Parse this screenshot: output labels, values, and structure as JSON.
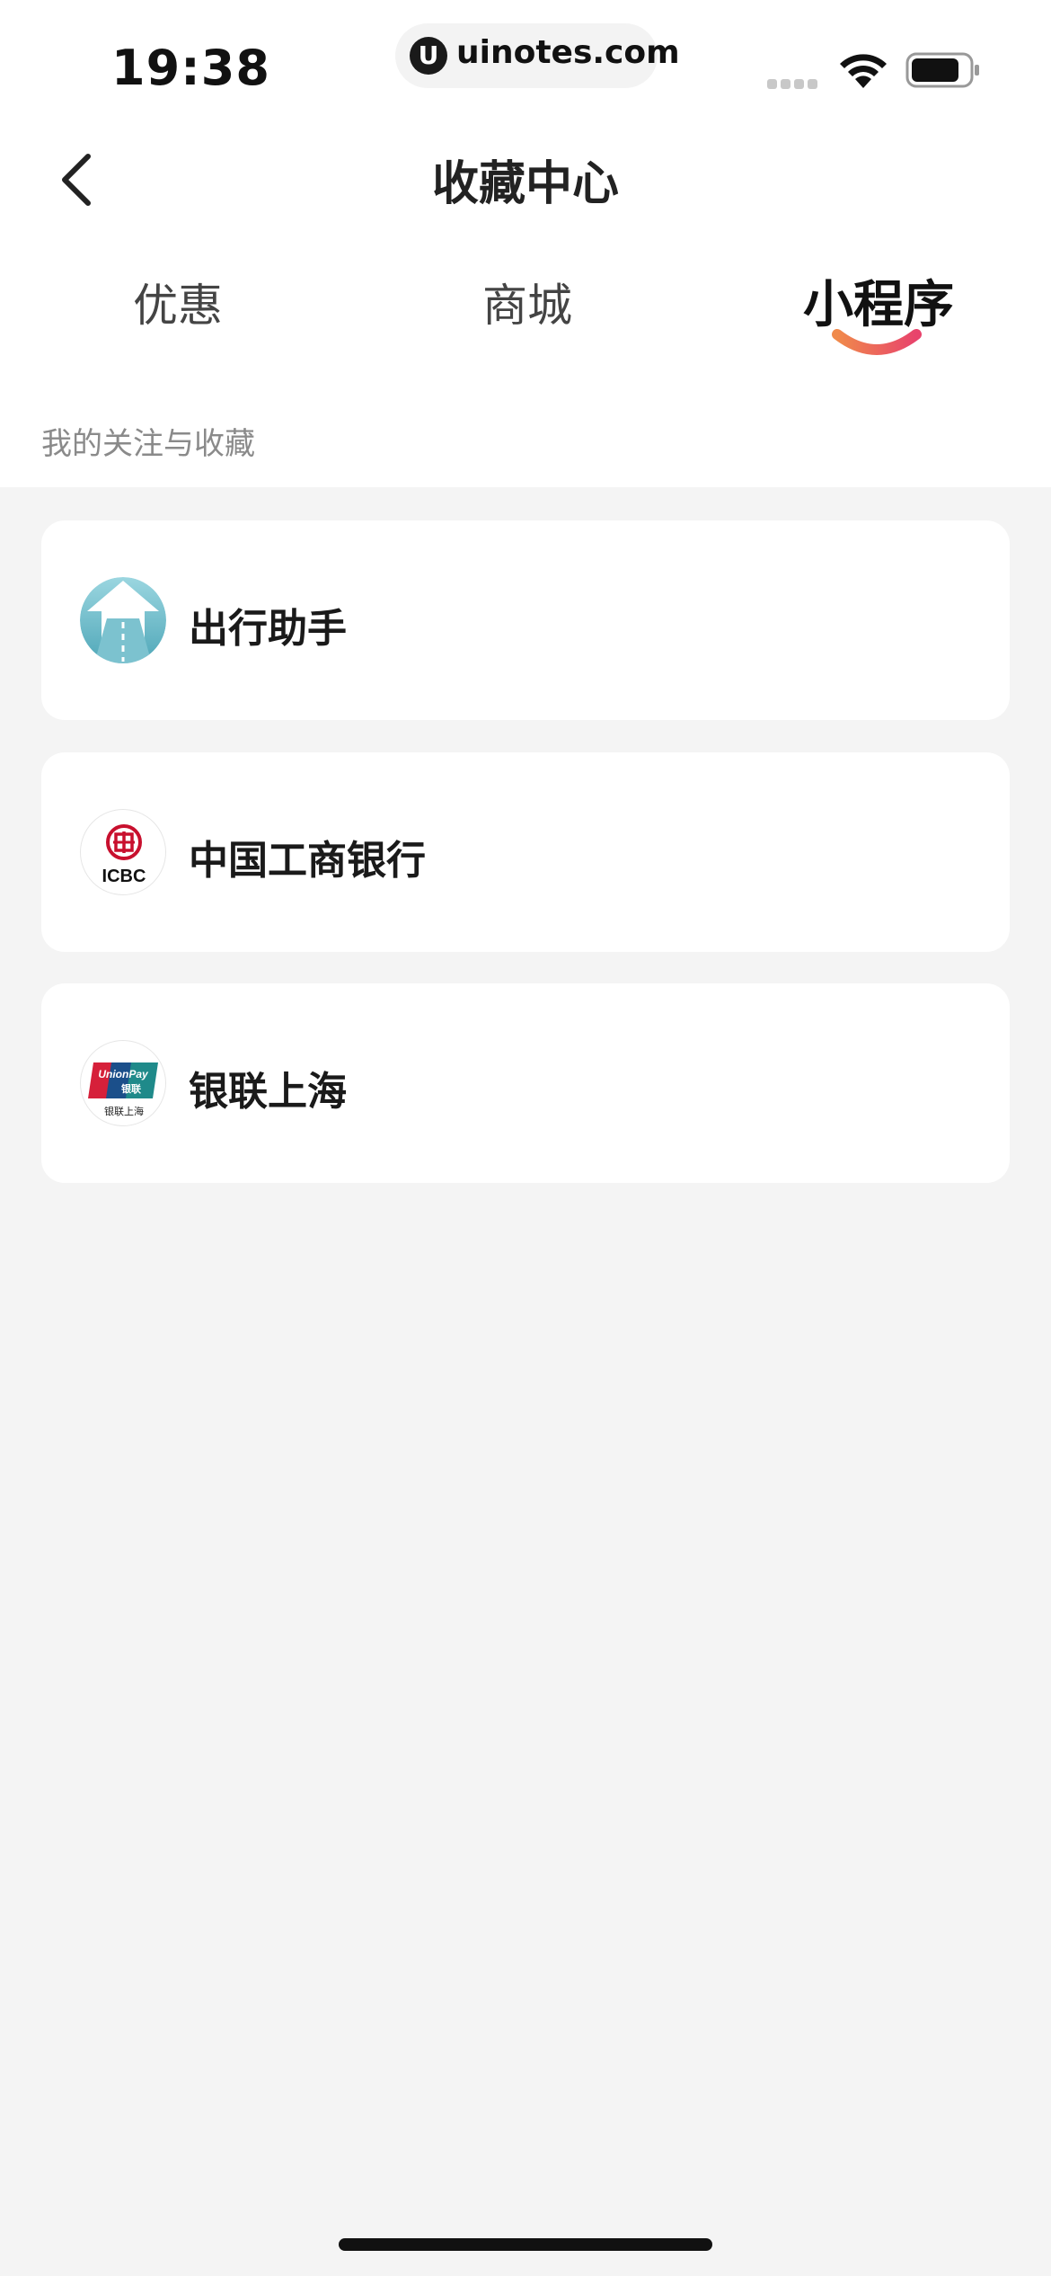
{
  "status_bar": {
    "time": "19:38",
    "url": "uinotes.com",
    "url_logo": "U"
  },
  "header": {
    "title": "收藏中心",
    "back_icon": "chevron-left-icon"
  },
  "tabs": [
    {
      "label": "优惠",
      "active": false
    },
    {
      "label": "商城",
      "active": false
    },
    {
      "label": "小程序",
      "active": true
    }
  ],
  "section": {
    "label": "我的关注与收藏"
  },
  "mini_programs": [
    {
      "name": "出行助手",
      "icon": "road-arrow-icon"
    },
    {
      "name": "中国工商银行",
      "icon": "icbc-logo-icon",
      "icon_text": "ICBC"
    },
    {
      "name": "银联上海",
      "icon": "unionpay-logo-icon",
      "icon_text": "UnionPay",
      "icon_subtext": "银联",
      "icon_caption": "银联上海"
    }
  ],
  "colors": {
    "accent_start": "#f08a4b",
    "accent_end": "#e8436c",
    "background": "#f4f4f4",
    "card": "#ffffff"
  }
}
